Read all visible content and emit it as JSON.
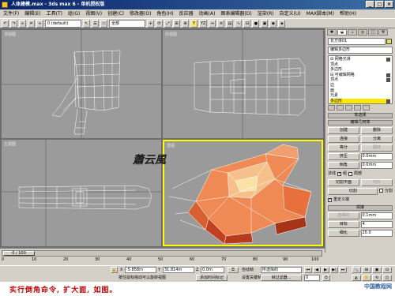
{
  "window": {
    "title": "人体建模.max - 3ds max 6 - 单机授权版",
    "buttons": [
      "_",
      "□",
      "×"
    ]
  },
  "menu": [
    "文件(F)",
    "编辑(E)",
    "工具(T)",
    "组(G)",
    "视图(V)",
    "创建(C)",
    "修改器(O)",
    "角色(H)",
    "反应器",
    "动画(A)",
    "图表编辑器(D)",
    "渲染(R)",
    "自定义(U)",
    "MAX脚本(M)",
    "帮助(H)"
  ],
  "toolbar": {
    "filter": "全部",
    "axis_y": "Y",
    "axis_yz": "YZ",
    "count": "0 (default)"
  },
  "viewports": {
    "top_label": "顶视图",
    "front_label": "前视图",
    "left_label": "左视图",
    "perspective_label": "透视"
  },
  "panel": {
    "object_name": "长方体01",
    "modifier_list": "编辑多边形",
    "stack": [
      {
        "label": "⊟ 网格光滑"
      },
      {
        "label": "  顶点"
      },
      {
        "label": "  多边形"
      },
      {
        "label": "⊟ 可编辑网格"
      },
      {
        "label": "  顶点"
      },
      {
        "label": "  边"
      },
      {
        "label": "  面"
      },
      {
        "label": "  元素"
      },
      {
        "label": "  多边形"
      }
    ],
    "rollout_selection": "软选择",
    "rollout_edit": "编辑几何体",
    "buttons": {
      "create": "创建",
      "delete": "删除",
      "attach": "连接",
      "detach": "分离",
      "divide": "等分",
      "turn": "翻转",
      "extrude": "挤压",
      "bevel": "倒角",
      "extrude_val": "0.0mm",
      "bevel_val": "0.0mm",
      "normal_label": "法线",
      "group": "组",
      "local": "局部",
      "slice_plane": "切割平面",
      "slice": "切片",
      "cut": "切割",
      "split": "分割",
      "refine_ends": "重定义端",
      "weld": "焊接",
      "selected": "选择的",
      "threshold": "目标",
      "weld_val": "0.1mm",
      "target_val": "4",
      "tessellate": "细化",
      "tess_val": "25.0"
    }
  },
  "timeline": {
    "frame": "0 / 100",
    "ticks": [
      "0",
      "10",
      "20",
      "30",
      "40",
      "50",
      "60",
      "70",
      "80",
      "90",
      "100"
    ]
  },
  "status": {
    "x_label": "X",
    "x_val": "-5.858m",
    "y_label": "Y",
    "y_val": "31.814m",
    "z_label": "Z",
    "z_val": "0.0m",
    "auto_key": "自动帧",
    "set_key": "设置关键帧",
    "selection_set": "所选择的",
    "key_filters": "帧过滤器...",
    "prompt": "按住鼠标拖动可以旋转视图",
    "add_time_tag": "添加时间标记",
    "frame_num": "0"
  },
  "caption": {
    "text": "实行倒角命令, 扩大面, 如图。",
    "logo": "中国教程网",
    "signature": "蕭云風"
  },
  "colors": {
    "title_bar": "#0a246a",
    "viewport_bg": "#9b9b9b",
    "active_border": "#ffff00",
    "mesh_orange": "#f0a070",
    "caption_red": "#c00000"
  }
}
